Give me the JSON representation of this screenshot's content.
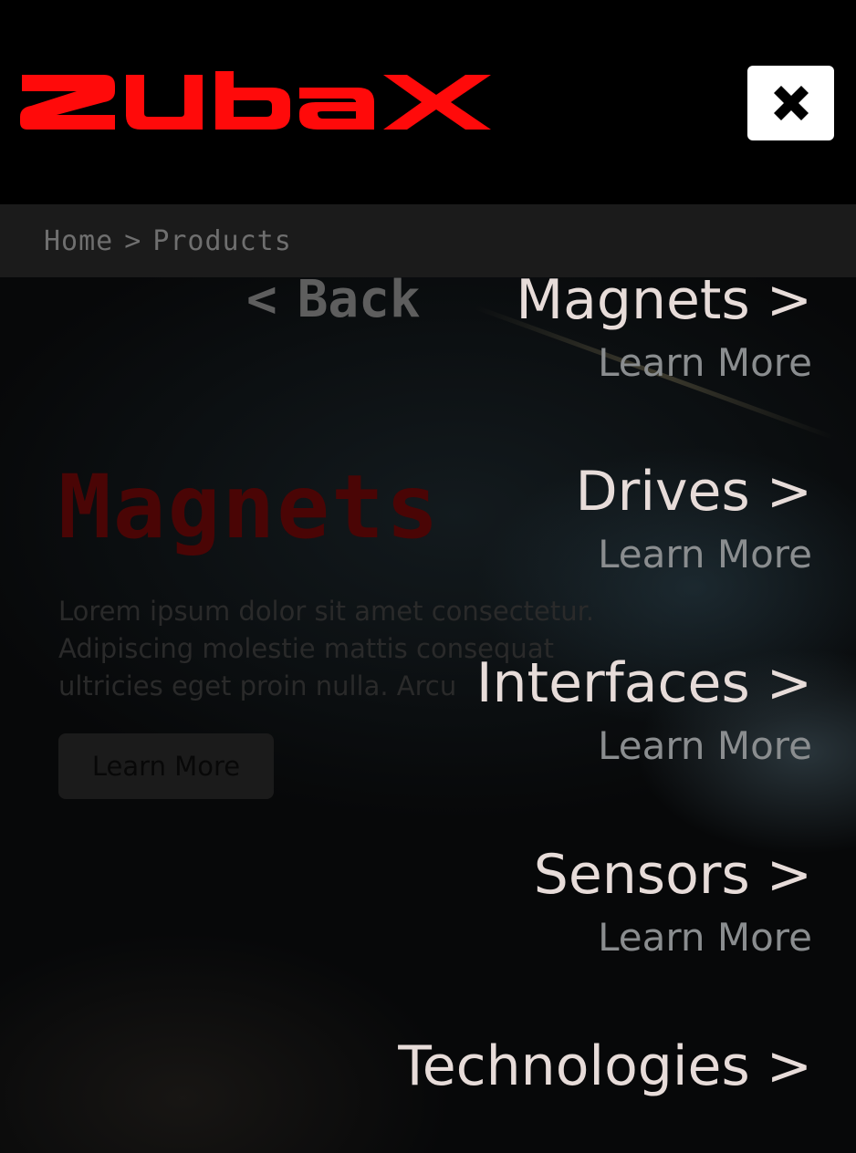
{
  "brand": {
    "logo_text": "zubax",
    "color": "#ff0a0a"
  },
  "header": {
    "close_icon": "close-icon"
  },
  "breadcrumb": {
    "items": [
      "Home",
      "Products"
    ],
    "separator": ">"
  },
  "hero": {
    "title": "Magnets",
    "description": "Lorem ipsum dolor sit amet consectetur. Adipiscing molestie mattis consequat ultricies eget proin nulla. Arcu",
    "button_label": "Learn More"
  },
  "menu": {
    "back_arrow": "<",
    "back_label": "Back",
    "chevron": ">",
    "items": [
      {
        "label": "Magnets",
        "learn": "Learn More"
      },
      {
        "label": "Drives",
        "learn": "Learn More"
      },
      {
        "label": "Interfaces",
        "learn": "Learn More"
      },
      {
        "label": "Sensors",
        "learn": "Learn More"
      },
      {
        "label": "Technologies"
      }
    ]
  }
}
